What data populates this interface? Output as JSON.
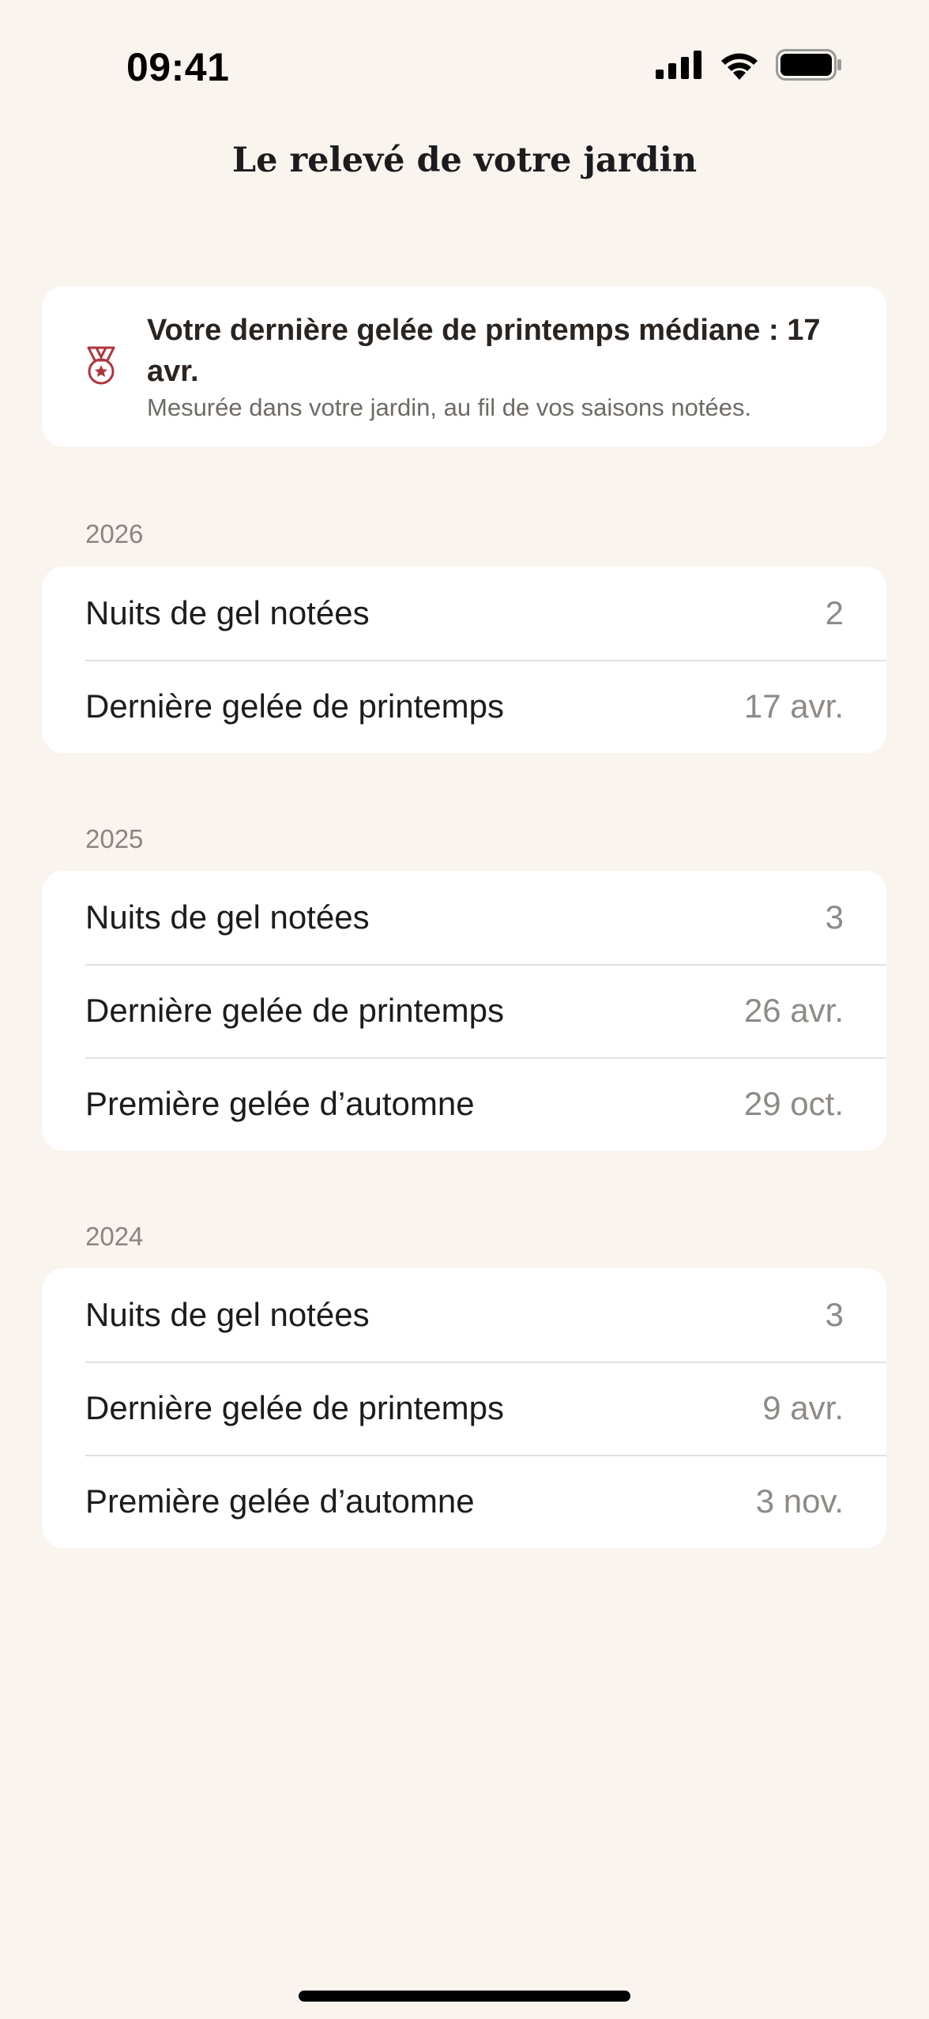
{
  "status_bar": {
    "time": "09:41",
    "icons": [
      "cellular-signal-icon",
      "wifi-icon",
      "battery-icon"
    ]
  },
  "nav": {
    "title": "Le relevé de votre jardin"
  },
  "highlight": {
    "icon": "medal-icon",
    "icon_color": "#b0343c",
    "title": "Votre dernière gelée de printemps médiane : 17 avr.",
    "subtitle": "Mesurée dans votre jardin, au fil de vos saisons notées."
  },
  "sections": [
    {
      "year": "2026",
      "rows": [
        {
          "label": "Nuits de gel notées",
          "value": "2"
        },
        {
          "label": "Dernière gelée de printemps",
          "value": "17 avr."
        }
      ]
    },
    {
      "year": "2025",
      "rows": [
        {
          "label": "Nuits de gel notées",
          "value": "3"
        },
        {
          "label": "Dernière gelée de printemps",
          "value": "26 avr."
        },
        {
          "label": "Première gelée d’automne",
          "value": "29 oct."
        }
      ]
    },
    {
      "year": "2024",
      "rows": [
        {
          "label": "Nuits de gel notées",
          "value": "3"
        },
        {
          "label": "Dernière gelée de printemps",
          "value": "9 avr."
        },
        {
          "label": "Première gelée d’automne",
          "value": "3 nov."
        }
      ]
    }
  ],
  "colors": {
    "background": "#f9f4ee",
    "card": "#ffffff",
    "accent": "#b0343c",
    "secondary_text": "#8e8a86"
  }
}
